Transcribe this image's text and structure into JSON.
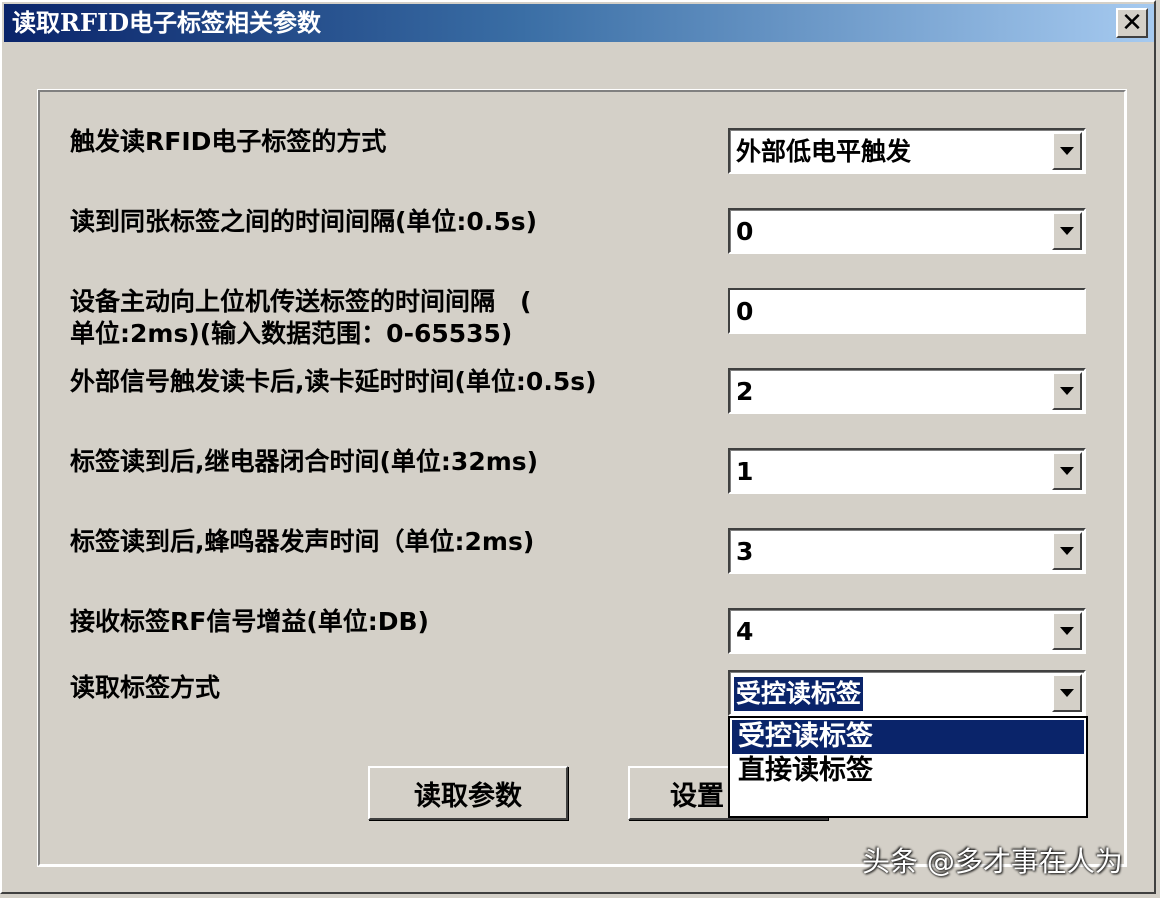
{
  "window": {
    "title": "读取RFID电子标签相关参数",
    "close_glyph": "✕"
  },
  "fields": [
    {
      "label": "触发读RFID电子标签的方式",
      "value": "外部低电平触发"
    },
    {
      "label": "读到同张标签之间的时间间隔(单位:0.5s)",
      "value": "0"
    },
    {
      "label_line1": "设备主动向上位机传送标签的时间间隔　(",
      "label_line2": "单位:2ms)(输入数据范围：0-65535)",
      "value": "0"
    },
    {
      "label": "外部信号触发读卡后,读卡延时时间(单位:0.5s)",
      "value": "2"
    },
    {
      "label": "标签读到后,继电器闭合时间(单位:32ms)",
      "value": "1"
    },
    {
      "label": "标签读到后,蜂鸣器发声时间（单位:2ms)",
      "value": "3"
    },
    {
      "label": "接收标签RF信号增益(单位:DB)",
      "value": "4"
    },
    {
      "label": "读取标签方式",
      "value": "受控读标签"
    }
  ],
  "dropdown": {
    "options": [
      "受控读标签",
      "直接读标签"
    ]
  },
  "buttons": {
    "read": "读取参数",
    "set": "设置"
  },
  "watermark": "头条 @多才事在人为",
  "colors": {
    "titlebar_start": "#0a246a",
    "titlebar_end": "#a6caf0",
    "selection": "#0a246a",
    "face": "#d4d0c8"
  }
}
